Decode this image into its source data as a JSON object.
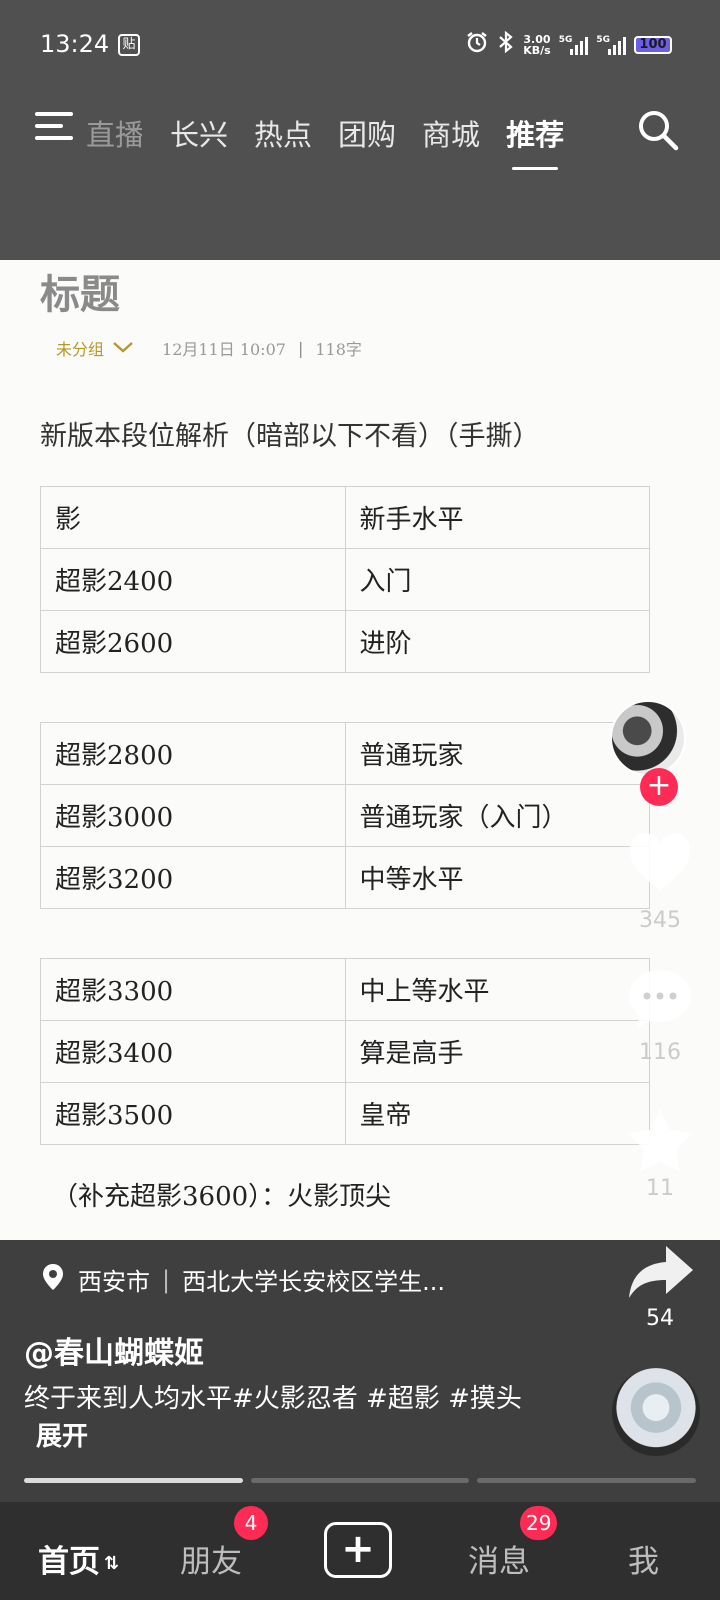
{
  "status_bar": {
    "time": "13:24",
    "notification_badge": "贴",
    "net_speed_value": "3.00",
    "net_speed_unit": "KB/s",
    "signal_label_1": "5G",
    "signal_label_2": "5G",
    "battery": "100"
  },
  "top_tabs": {
    "faded_tab": "直播",
    "tabs": [
      "长兴",
      "热点",
      "团购",
      "商城"
    ],
    "active_tab": "推荐"
  },
  "note": {
    "title": "标题",
    "group": "未分组",
    "datetime": "12月11日 10:07",
    "word_count": "118字",
    "heading": "新版本段位解析（暗部以下不看）（手撕）",
    "table1": [
      [
        "影",
        "新手水平"
      ],
      [
        "超影2400",
        "入门"
      ],
      [
        "超影2600",
        "进阶"
      ]
    ],
    "table2": [
      [
        "超影2800",
        "普通玩家"
      ],
      [
        "超影3000",
        "普通玩家（入门）"
      ],
      [
        "超影3200",
        "中等水平"
      ]
    ],
    "table3": [
      [
        "超影3300",
        "中上等水平"
      ],
      [
        "超影3400",
        "算是高手"
      ],
      [
        "超影3500",
        "皇帝"
      ]
    ],
    "footnote": "（补充超影3600）：火影顶尖"
  },
  "actions": {
    "likes": "345",
    "comments": "116",
    "favorites": "11",
    "shares": "54"
  },
  "video_info": {
    "location_city": "西安市",
    "location_place": "西北大学长安校区学生...",
    "author": "@春山蝴蝶姬",
    "description": "终于来到人均水平#火影忍者 #超影 #摸头",
    "expand_label": "展开"
  },
  "bottom_nav": {
    "home": "首页",
    "friends": "朋友",
    "friends_badge": "4",
    "messages": "消息",
    "messages_badge": "29",
    "me": "我"
  },
  "colors": {
    "accent_red": "#fe2c55",
    "header_bg": "#505050",
    "overlay_bg": "#3f3f3f",
    "nav_bg": "#2f2f2f",
    "group_gold": "#b8962a"
  }
}
